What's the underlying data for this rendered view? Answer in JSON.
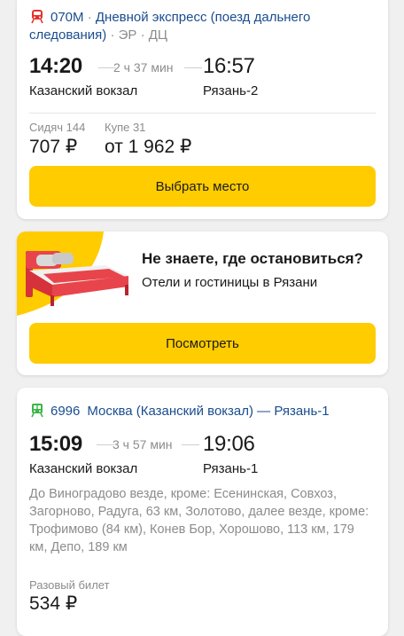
{
  "trains": [
    {
      "number": "070М",
      "separator": " · ",
      "route": "Дневной экспресс (поезд дальнего следования)",
      "tags": " · ЭР · ДЦ",
      "departure": "14:20",
      "duration": "2 ч 37 мин",
      "arrival": "16:57",
      "from": "Казанский вокзал",
      "to": "Рязань-2",
      "fares": [
        {
          "class": "Сидяч 144",
          "price": "707 ₽"
        },
        {
          "class": "Купе 31",
          "price": "от 1 962 ₽"
        }
      ],
      "button": "Выбрать место",
      "icon_color": "#e5322d"
    },
    {
      "number": "6996",
      "route": "Москва (Казанский вокзал) — Рязань-1",
      "departure": "15:09",
      "duration": "3 ч 57 мин",
      "arrival": "19:06",
      "from": "Казанский вокзал",
      "to": "Рязань-1",
      "stops": "До Виноградово везде, кроме: Есенинская, Совхоз, Загорново, Радуга, 63 км, Золотово, далее везде, кроме: Трофимово (84 км), Конев Бор, Хорошово, 113 км, 179 км, Депо, 189 км",
      "fare_label": "Разовый билет",
      "price": "534 ₽",
      "icon_color": "#3bb54a"
    }
  ],
  "promo": {
    "title": "Не знаете, где остановиться?",
    "subtitle": "Отели и гостиницы в Рязани",
    "button": "Посмотреть",
    "icon": "bed-icon",
    "accent": "#ffcc00"
  },
  "colors": {
    "button": "#ffcc00",
    "link": "#1a4d8f",
    "muted": "#8c8c8c"
  }
}
